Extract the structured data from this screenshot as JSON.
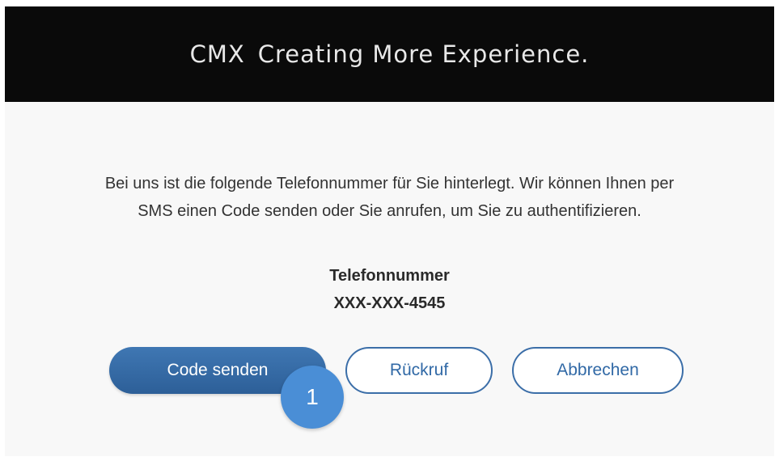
{
  "header": {
    "brand_mark": "CMX",
    "tagline": "Creating More Experience."
  },
  "dialog": {
    "message": "Bei uns ist die folgende Telefonnummer für Sie hinterlegt. Wir können Ihnen per SMS einen Code senden oder Sie anrufen, um Sie zu authentifizieren.",
    "phone_label": "Telefonnummer",
    "phone_number": "XXX-XXX-4545"
  },
  "buttons": {
    "send_code": "Code senden",
    "callback": "Rückruf",
    "cancel": "Abbrechen"
  },
  "annotation": {
    "step_number": "1"
  },
  "colors": {
    "header_bg": "#0a0a0a",
    "primary": "#2d5f98",
    "outline": "#3b6ea8",
    "badge": "#4a8ed6"
  }
}
